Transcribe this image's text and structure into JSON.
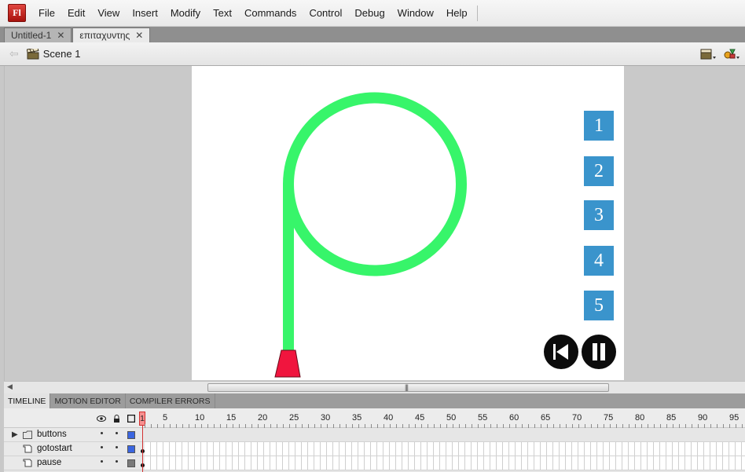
{
  "app": {
    "logo": "Fl"
  },
  "menu": [
    "File",
    "Edit",
    "View",
    "Insert",
    "Modify",
    "Text",
    "Commands",
    "Control",
    "Debug",
    "Window",
    "Help"
  ],
  "tabs": [
    {
      "label": "Untitled-1",
      "active": false
    },
    {
      "label": "επιταχυντης",
      "active": true
    }
  ],
  "scene": {
    "label": "Scene 1"
  },
  "stage": {
    "buttons": [
      "1",
      "2",
      "3",
      "4",
      "5"
    ],
    "track_color": "#37f56a",
    "car_color": "#f0153e",
    "button_color": "#3a94cc"
  },
  "panel_tabs": [
    "TIMELINE",
    "MOTION EDITOR",
    "COMPILER ERRORS"
  ],
  "timeline": {
    "current_frame": "1",
    "frame_labels": [
      "5",
      "10",
      "15",
      "20",
      "25",
      "30",
      "35",
      "40",
      "45",
      "50",
      "55",
      "60",
      "65",
      "70",
      "75",
      "80",
      "85",
      "90",
      "95"
    ],
    "layers": [
      {
        "name": "buttons",
        "type": "folder",
        "color": "#3b66e0"
      },
      {
        "name": "gotostart",
        "type": "layer",
        "color": "#3b66e0"
      },
      {
        "name": "pause",
        "type": "layer",
        "color": "#7a7a7a"
      }
    ]
  }
}
